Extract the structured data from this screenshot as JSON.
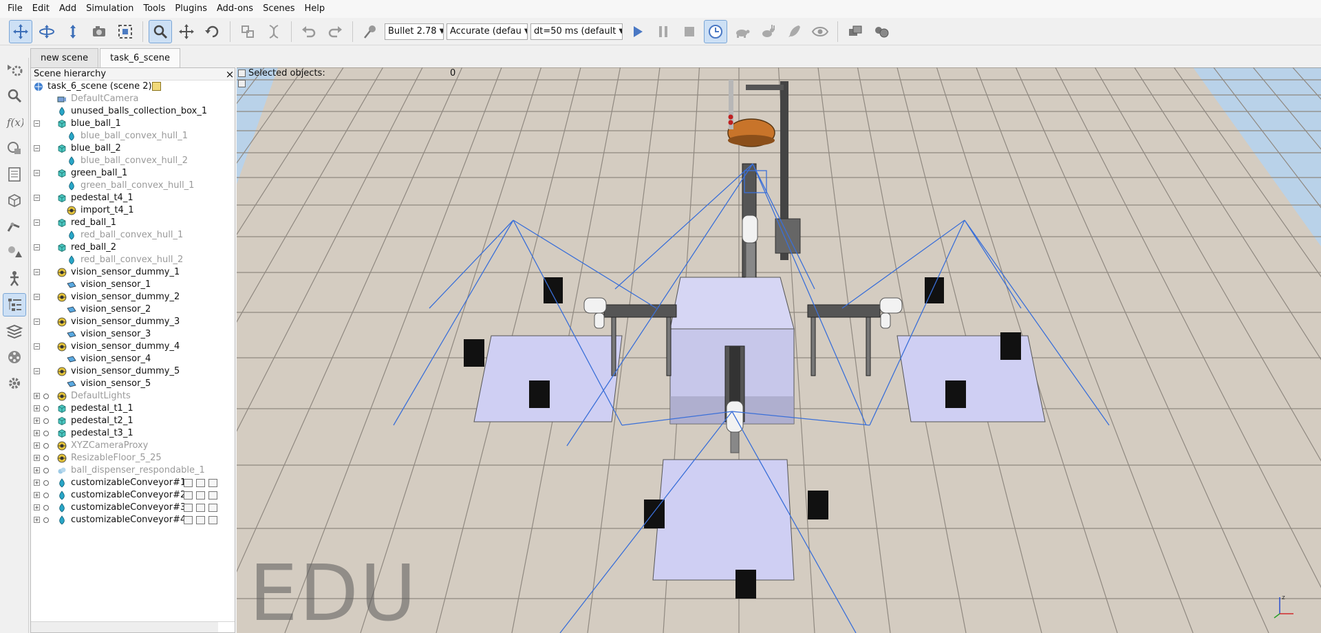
{
  "menu": [
    "File",
    "Edit",
    "Add",
    "Simulation",
    "Tools",
    "Plugins",
    "Add-ons",
    "Scenes",
    "Help"
  ],
  "toolbar": {
    "engine": "Bullet 2.78",
    "accuracy": "Accurate (defau",
    "timestep": "dt=50 ms (default"
  },
  "tabs": [
    "new scene",
    "task_6_scene"
  ],
  "hierarchy": {
    "title": "Scene hierarchy",
    "close": "×",
    "items": [
      {
        "label": "task_6_scene (scene 2)",
        "depth": 0,
        "icon": "scene-icon",
        "dim": false
      },
      {
        "label": "DefaultCamera",
        "depth": 1,
        "icon": "camera-icon",
        "dim": true
      },
      {
        "label": "unused_balls_collection_box_1",
        "depth": 1,
        "icon": "shape-icon",
        "dim": false
      },
      {
        "label": "blue_ball_1",
        "depth": 1,
        "icon": "cube-icon",
        "dim": false
      },
      {
        "label": "blue_ball_convex_hull_1",
        "depth": 2,
        "icon": "shape-icon",
        "dim": true
      },
      {
        "label": "blue_ball_2",
        "depth": 1,
        "icon": "cube-icon",
        "dim": false
      },
      {
        "label": "blue_ball_convex_hull_2",
        "depth": 2,
        "icon": "shape-icon",
        "dim": true
      },
      {
        "label": "green_ball_1",
        "depth": 1,
        "icon": "cube-icon",
        "dim": false
      },
      {
        "label": "green_ball_convex_hull_1",
        "depth": 2,
        "icon": "shape-icon",
        "dim": true
      },
      {
        "label": "pedestal_t4_1",
        "depth": 1,
        "icon": "cube-icon",
        "dim": false
      },
      {
        "label": "import_t4_1",
        "depth": 2,
        "icon": "dummy-icon",
        "dim": false
      },
      {
        "label": "red_ball_1",
        "depth": 1,
        "icon": "cube-icon",
        "dim": false
      },
      {
        "label": "red_ball_convex_hull_1",
        "depth": 2,
        "icon": "shape-icon",
        "dim": true
      },
      {
        "label": "red_ball_2",
        "depth": 1,
        "icon": "cube-icon",
        "dim": false
      },
      {
        "label": "red_ball_convex_hull_2",
        "depth": 2,
        "icon": "shape-icon",
        "dim": true
      },
      {
        "label": "vision_sensor_dummy_1",
        "depth": 1,
        "icon": "dummy-icon",
        "dim": false
      },
      {
        "label": "vision_sensor_1",
        "depth": 2,
        "icon": "vision-sensor-icon",
        "dim": false
      },
      {
        "label": "vision_sensor_dummy_2",
        "depth": 1,
        "icon": "dummy-icon",
        "dim": false
      },
      {
        "label": "vision_sensor_2",
        "depth": 2,
        "icon": "vision-sensor-icon",
        "dim": false
      },
      {
        "label": "vision_sensor_dummy_3",
        "depth": 1,
        "icon": "dummy-icon",
        "dim": false
      },
      {
        "label": "vision_sensor_3",
        "depth": 2,
        "icon": "vision-sensor-icon",
        "dim": false
      },
      {
        "label": "vision_sensor_dummy_4",
        "depth": 1,
        "icon": "dummy-icon",
        "dim": false
      },
      {
        "label": "vision_sensor_4",
        "depth": 2,
        "icon": "vision-sensor-icon",
        "dim": false
      },
      {
        "label": "vision_sensor_dummy_5",
        "depth": 1,
        "icon": "dummy-icon",
        "dim": false
      },
      {
        "label": "vision_sensor_5",
        "depth": 2,
        "icon": "vision-sensor-icon",
        "dim": false
      },
      {
        "label": "DefaultLights",
        "depth": 1,
        "icon": "dummy-icon",
        "dim": true
      },
      {
        "label": "pedestal_t1_1",
        "depth": 1,
        "icon": "cube-icon",
        "dim": false
      },
      {
        "label": "pedestal_t2_1",
        "depth": 1,
        "icon": "cube-icon",
        "dim": false
      },
      {
        "label": "pedestal_t3_1",
        "depth": 1,
        "icon": "cube-icon",
        "dim": false
      },
      {
        "label": "XYZCameraProxy",
        "depth": 1,
        "icon": "dummy-icon",
        "dim": true
      },
      {
        "label": "ResizableFloor_5_25",
        "depth": 1,
        "icon": "dummy-icon",
        "dim": true
      },
      {
        "label": "ball_dispenser_respondable_1",
        "depth": 1,
        "icon": "cluster-icon",
        "dim": true
      },
      {
        "label": "customizableConveyor#1",
        "depth": 1,
        "icon": "shape-icon",
        "dim": false
      },
      {
        "label": "customizableConveyor#2",
        "depth": 1,
        "icon": "shape-icon",
        "dim": false
      },
      {
        "label": "customizableConveyor#3",
        "depth": 1,
        "icon": "shape-icon",
        "dim": false
      },
      {
        "label": "customizableConveyor#4",
        "depth": 1,
        "icon": "shape-icon",
        "dim": false
      }
    ]
  },
  "viewport": {
    "selected_label": "Selected objects:",
    "selected_count": "0",
    "watermark": "EDU",
    "axis_label": "z"
  },
  "colors": {
    "accent": "#cde0f5",
    "sky": "#b9d2e9",
    "tile_light": "#ddd6cc",
    "tile_dark": "#c2b9ad",
    "pedestal": "#cfcff0",
    "sensor_lines": "#3a6fd8"
  }
}
